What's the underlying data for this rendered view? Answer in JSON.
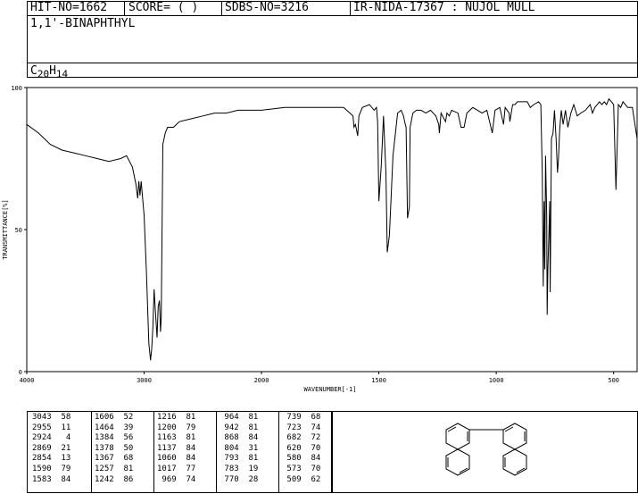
{
  "header": {
    "hit_no": "HIT-NO=1662",
    "score": "SCORE=  (   )",
    "sdbs_no": "SDBS-NO=3216",
    "ir_no": "IR-NIDA-17367 : NUJOL MULL"
  },
  "compound": {
    "name": "1,1'-BINAPHTHYL",
    "formula_base": "C",
    "formula_c": "20",
    "formula_h_base": "H",
    "formula_h": "14"
  },
  "chart_data": {
    "type": "line",
    "xlabel": "WAVENUMBER[-1]",
    "ylabel": "TRANSMITTANCE[%]",
    "xlim": [
      4000,
      400
    ],
    "ylim": [
      0,
      100
    ],
    "x_ticks": [
      "4000",
      "3000",
      "2000",
      "1500",
      "1000",
      "500"
    ],
    "y_ticks": [
      "100",
      "50",
      "0"
    ],
    "x": [
      4000,
      3900,
      3800,
      3700,
      3600,
      3500,
      3400,
      3300,
      3200,
      3150,
      3100,
      3070,
      3055,
      3045,
      3035,
      3025,
      3000,
      2980,
      2960,
      2945,
      2935,
      2925,
      2915,
      2905,
      2890,
      2880,
      2869,
      2860,
      2854,
      2840,
      2820,
      2800,
      2750,
      2700,
      2600,
      2500,
      2400,
      2300,
      2200,
      2100,
      2000,
      1900,
      1800,
      1700,
      1650,
      1610,
      1606,
      1600,
      1590,
      1585,
      1570,
      1540,
      1520,
      1510,
      1505,
      1500,
      1490,
      1480,
      1470,
      1464,
      1455,
      1440,
      1420,
      1405,
      1395,
      1390,
      1384,
      1378,
      1370,
      1367,
      1355,
      1340,
      1320,
      1300,
      1280,
      1257,
      1245,
      1242,
      1235,
      1216,
      1210,
      1200,
      1190,
      1163,
      1150,
      1137,
      1125,
      1100,
      1080,
      1060,
      1040,
      1017,
      1005,
      985,
      969,
      962,
      945,
      942,
      930,
      920,
      910,
      900,
      880,
      868,
      855,
      840,
      820,
      810,
      804,
      800,
      796,
      793,
      790,
      785,
      783,
      780,
      776,
      772,
      770,
      765,
      758,
      752,
      745,
      739,
      735,
      730,
      723,
      715,
      705,
      695,
      682,
      670,
      655,
      640,
      620,
      600,
      590,
      580,
      570,
      560,
      550,
      540,
      530,
      520,
      509,
      500,
      490,
      480,
      470,
      460,
      450,
      440,
      420,
      400
    ],
    "y": [
      87,
      84,
      80,
      78,
      77,
      76,
      75,
      74,
      75,
      76,
      72,
      66,
      61,
      67,
      62,
      67,
      55,
      35,
      10,
      4,
      8,
      16,
      29,
      22,
      12,
      23,
      25,
      14,
      19,
      80,
      84,
      86,
      86,
      88,
      89,
      90,
      91,
      91,
      92,
      92,
      92,
      93,
      93,
      93,
      93,
      90,
      86,
      87,
      83,
      90,
      93,
      94,
      92,
      93,
      88,
      60,
      72,
      90,
      70,
      42,
      48,
      76,
      91,
      92,
      90,
      88,
      86,
      54,
      58,
      86,
      91,
      92,
      92,
      91,
      92,
      90,
      87,
      84,
      91,
      88,
      91,
      90,
      92,
      91,
      86,
      86,
      91,
      93,
      92,
      91,
      92,
      84,
      92,
      93,
      87,
      93,
      91,
      88,
      94,
      94,
      95,
      95,
      95,
      95,
      93,
      94,
      95,
      94,
      70,
      30,
      60,
      36,
      76,
      55,
      20,
      36,
      48,
      60,
      28,
      82,
      84,
      92,
      82,
      70,
      75,
      85,
      92,
      87,
      92,
      86,
      91,
      94,
      90,
      91,
      92,
      94,
      91,
      93,
      94,
      95,
      94,
      95,
      94,
      96,
      95,
      94,
      64,
      94,
      93,
      95,
      94,
      93,
      93,
      82,
      75,
      70
    ]
  },
  "peaks": [
    [
      "3043",
      "58"
    ],
    [
      "2955",
      "11"
    ],
    [
      "2924",
      "4"
    ],
    [
      "2869",
      "21"
    ],
    [
      "2854",
      "13"
    ],
    [
      "1590",
      "79"
    ],
    [
      "1583",
      "84"
    ],
    [
      "1606",
      "52"
    ],
    [
      "1464",
      "39"
    ],
    [
      "1384",
      "56"
    ],
    [
      "1378",
      "50"
    ],
    [
      "1367",
      "68"
    ],
    [
      "1257",
      "81"
    ],
    [
      "1242",
      "86"
    ],
    [
      "1216",
      "81"
    ],
    [
      "1200",
      "79"
    ],
    [
      "1163",
      "81"
    ],
    [
      "1137",
      "84"
    ],
    [
      "1060",
      "84"
    ],
    [
      "1017",
      "77"
    ],
    [
      "969",
      "74"
    ],
    [
      "964",
      "81"
    ],
    [
      "942",
      "81"
    ],
    [
      "868",
      "84"
    ],
    [
      "804",
      "31"
    ],
    [
      "793",
      "81"
    ],
    [
      "783",
      "19"
    ],
    [
      "770",
      "28"
    ],
    [
      "739",
      "68"
    ],
    [
      "723",
      "74"
    ],
    [
      "682",
      "72"
    ],
    [
      "620",
      "70"
    ],
    [
      "580",
      "84"
    ],
    [
      "573",
      "70"
    ],
    [
      "509",
      "62"
    ]
  ]
}
